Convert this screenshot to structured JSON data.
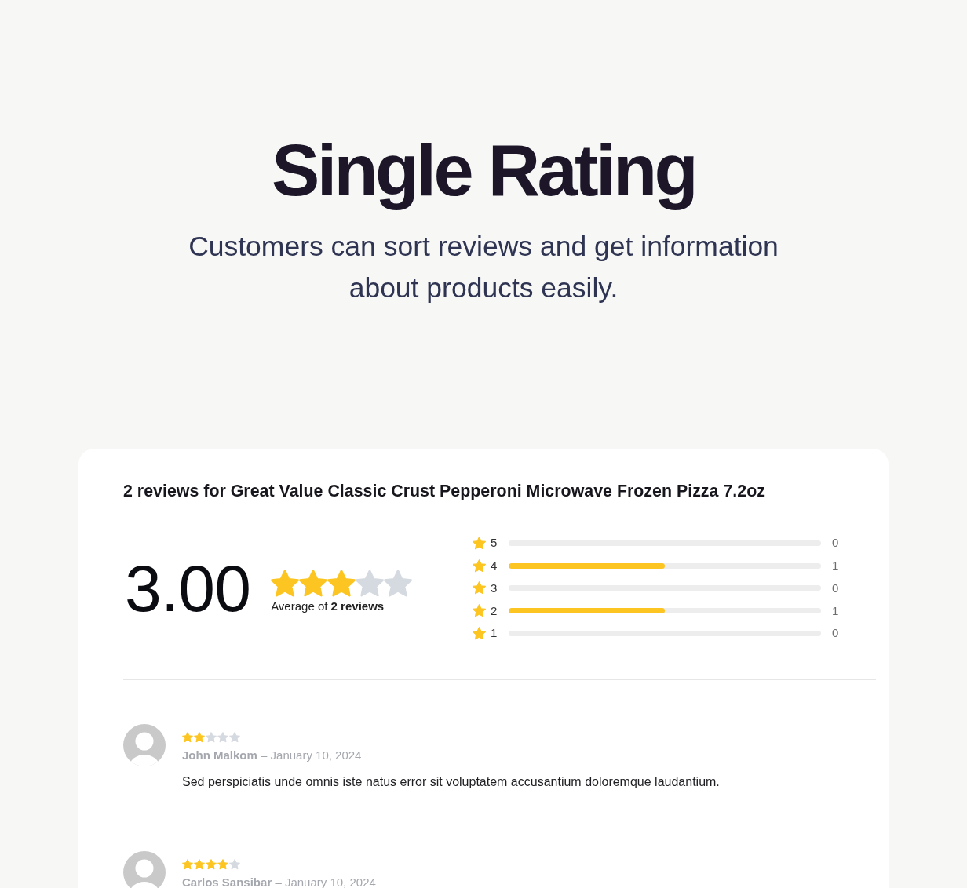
{
  "hero": {
    "title": "Single Rating",
    "subtitle": "Customers can sort reviews and get information about products easily."
  },
  "card": {
    "title": "2 reviews for Great Value Classic Crust Pepperoni Microwave Frozen Pizza 7.2oz",
    "summary": {
      "average": "3.00",
      "stars": 3,
      "caption": "Average of **2 reviews**"
    },
    "distribution": [
      {
        "label": "5",
        "level": 0,
        "count": "0"
      },
      {
        "label": "4",
        "level": 0.5,
        "count": "1"
      },
      {
        "label": "3",
        "level": 0,
        "count": "0"
      },
      {
        "label": "2",
        "level": 0.5,
        "count": "1"
      },
      {
        "label": "1",
        "level": 0,
        "count": "0"
      }
    ],
    "reviews": [
      {
        "stars": 2,
        "byline": "**John Malkom** – January 10, 2024",
        "text": "Sed perspiciatis unde omnis iste natus error sit voluptatem accusantium doloremque laudantium."
      },
      {
        "stars": 4,
        "byline": "**Carlos Sansibar** – January 10, 2024"
      }
    ]
  }
}
